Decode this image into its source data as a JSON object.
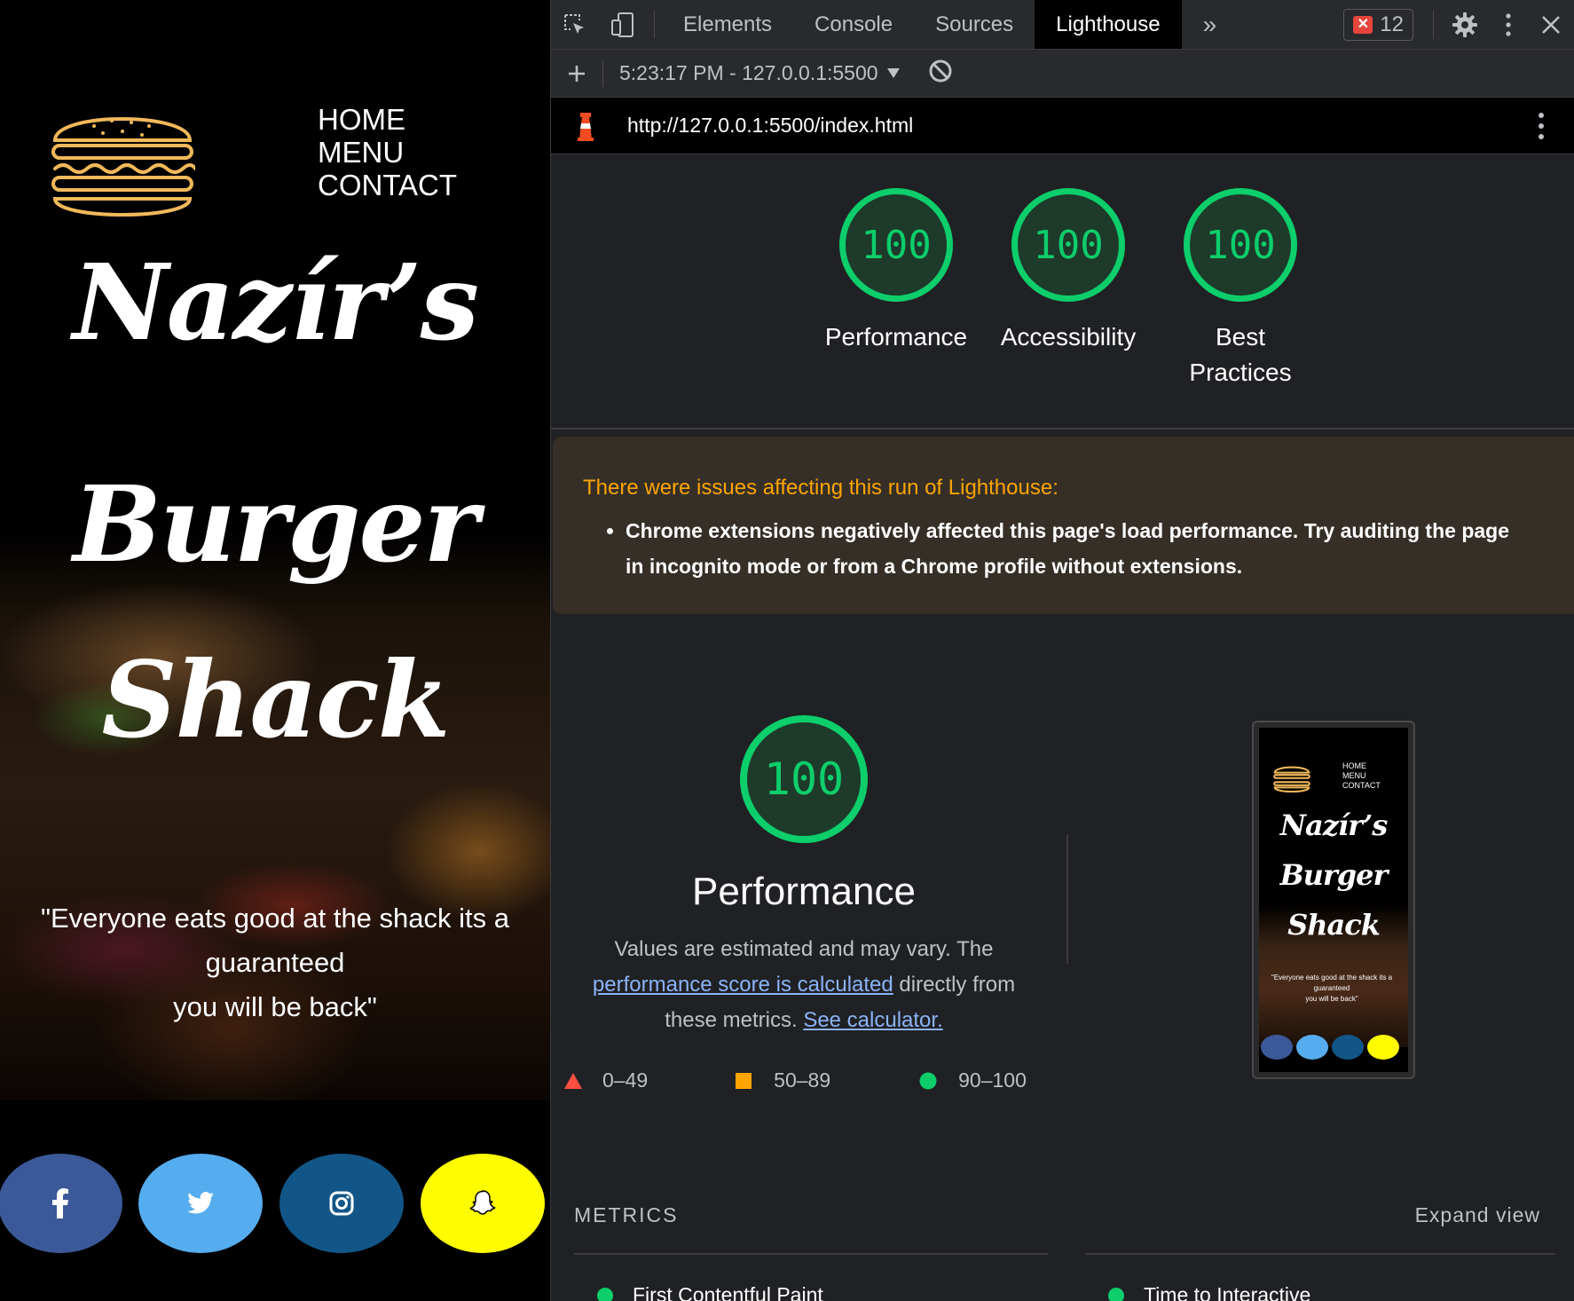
{
  "site": {
    "nav": [
      "HOME",
      "MENU",
      "CONTACT"
    ],
    "title_lines": [
      "Nazír’s",
      "Burger",
      "Shack"
    ],
    "tagline": [
      "\"Everyone eats good at the shack its a",
      "guaranteed",
      "you will be back\""
    ],
    "social": [
      {
        "name": "facebook",
        "icon": "facebook-icon",
        "color": "#3b5998",
        "glyph": "f"
      },
      {
        "name": "twitter",
        "icon": "twitter-icon",
        "color": "#55acee",
        "glyph": ""
      },
      {
        "name": "instagram",
        "icon": "instagram-icon",
        "color": "#125688",
        "glyph": ""
      },
      {
        "name": "snapchat",
        "icon": "snapchat-icon",
        "color": "#fffc00",
        "glyph": ""
      }
    ],
    "logo_color": "#f2b95a"
  },
  "devtools": {
    "tabs": [
      "Elements",
      "Console",
      "Sources",
      "Lighthouse"
    ],
    "active_tab": "Lighthouse",
    "more": "»",
    "error_count": "12",
    "report_selector": "5:23:17 PM - 127.0.0.1:5500",
    "url": "http://127.0.0.1:5500/index.html",
    "gauges": [
      {
        "score": "100",
        "label": "Performance"
      },
      {
        "score": "100",
        "label": "Accessibility"
      },
      {
        "score": "100",
        "label": "Best Practices"
      }
    ],
    "warning": {
      "heading": "There were issues affecting this run of Lighthouse:",
      "items": [
        "Chrome extensions negatively affected this page's load performance. Try auditing the page in incognito mode or from a Chrome profile without extensions."
      ]
    },
    "performance": {
      "score": "100",
      "title": "Performance",
      "desc_1": "Values are estimated and may vary. The",
      "link_1": "performance score is calculated",
      "desc_2": "directly from these metrics.",
      "link_2": "See calculator."
    },
    "legend": [
      {
        "range": "0–49",
        "color": "#ff4e42",
        "shape": "triangle"
      },
      {
        "range": "50–89",
        "color": "#ffa400",
        "shape": "square"
      },
      {
        "range": "90–100",
        "color": "#0cce6b",
        "shape": "circle"
      }
    ],
    "metrics_title": "METRICS",
    "expand_view": "Expand view",
    "metrics": [
      "First Contentful Paint",
      "Time to Interactive"
    ],
    "colors": {
      "pass": "#0cce6b",
      "warn_text": "#ffa400",
      "link": "#8ab4f8"
    }
  }
}
